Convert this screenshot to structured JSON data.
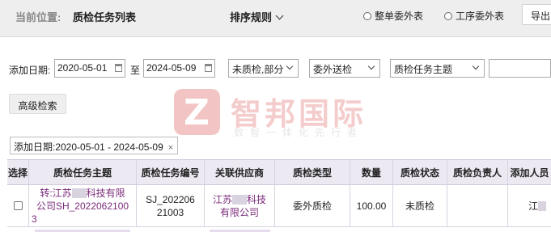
{
  "header": {
    "crumb_label": "当前位置:",
    "crumb_title": "质检任务列表",
    "sort_label": "排序规则",
    "radio_1": "整单委外表",
    "radio_2": "工序委外表",
    "export_label": "导出"
  },
  "filters": {
    "add_date_label": "添加日期:",
    "date_from": "2020-05-01",
    "to_label": "至",
    "date_to": "2024-05-09",
    "status_select": "未质检,部分",
    "type_select": "委外送检",
    "field_select": "质检任务主题",
    "keyword_input": "",
    "advanced_search": "高级检索"
  },
  "watermark": {
    "logo_letter": "Z",
    "brand": "智邦国际",
    "slogan": "数智一体化先行者"
  },
  "applied_tag": {
    "text": "添加日期:2020-05-01 - 2024-05-09",
    "close": "×"
  },
  "table": {
    "columns": [
      "选择",
      "质检任务主题",
      "质检任务编号",
      "关联供应商",
      "质检类型",
      "数量",
      "质检状态",
      "质检负责人",
      "添加人员"
    ],
    "rows": [
      {
        "subject_line1": "转:江苏",
        "subject_line1b": "科技有限",
        "subject_line2": "公司SH_2022062100",
        "subject_line3": "3",
        "code_line1": "SJ_202206",
        "code_line2": "21003",
        "supplier_line1a": "江苏",
        "supplier_line1b": "科技",
        "supplier_line2": "有限公司",
        "qc_type": "委外质检",
        "quantity": "100.00",
        "qc_status": "未质检",
        "owner": "",
        "added_by": "江"
      }
    ]
  }
}
